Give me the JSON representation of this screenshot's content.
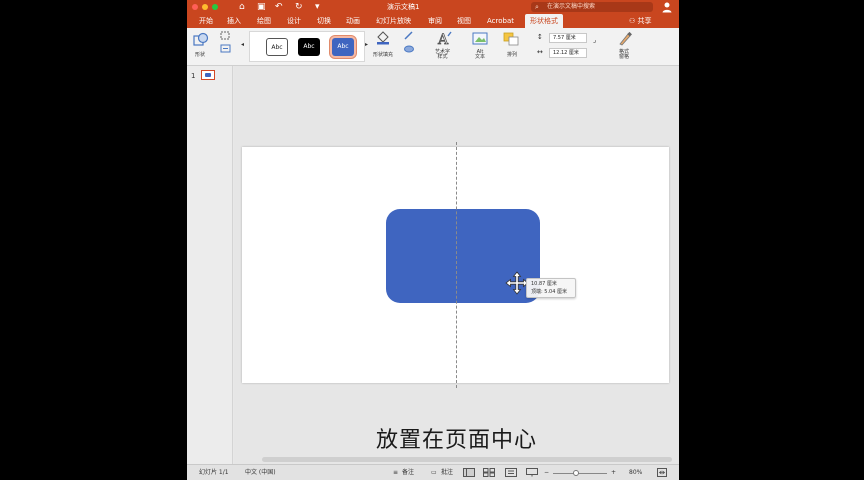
{
  "window": {
    "title": "演示文稿1",
    "search_placeholder": "在演示文稿中搜索"
  },
  "ribbon": {
    "tabs": [
      "开始",
      "插入",
      "绘图",
      "设计",
      "切换",
      "动画",
      "幻灯片放映",
      "审阅",
      "视图",
      "Acrobat",
      "形状格式"
    ],
    "active_tab": "形状格式",
    "share_label": "共享",
    "shape_label": "形状",
    "styles": [
      "Abc",
      "Abc",
      "Abc"
    ],
    "shape_fill_label": "形状填充",
    "wordart_label": "艺术字\n样式",
    "alt_text_label": "Alt\n文本",
    "arrange_label": "排列",
    "height_value": "7.57 厘米",
    "width_value": "12.12 厘米",
    "format_pane_label": "格式\n窗格"
  },
  "thumbnails": {
    "slide_number": "1"
  },
  "tooltip": {
    "line1": "10.87 厘米",
    "line2": "顶端: 5.04 厘米"
  },
  "caption": "放置在页面中心",
  "statusbar": {
    "slide_info": "幻灯片 1/1",
    "language": "中文 (中国)",
    "notes": "备注",
    "comments": "批注",
    "zoom": "80%",
    "zoom_fraction": 0.42
  },
  "colors": {
    "ribbon": "#c9461f",
    "shape": "#3f65c0"
  }
}
